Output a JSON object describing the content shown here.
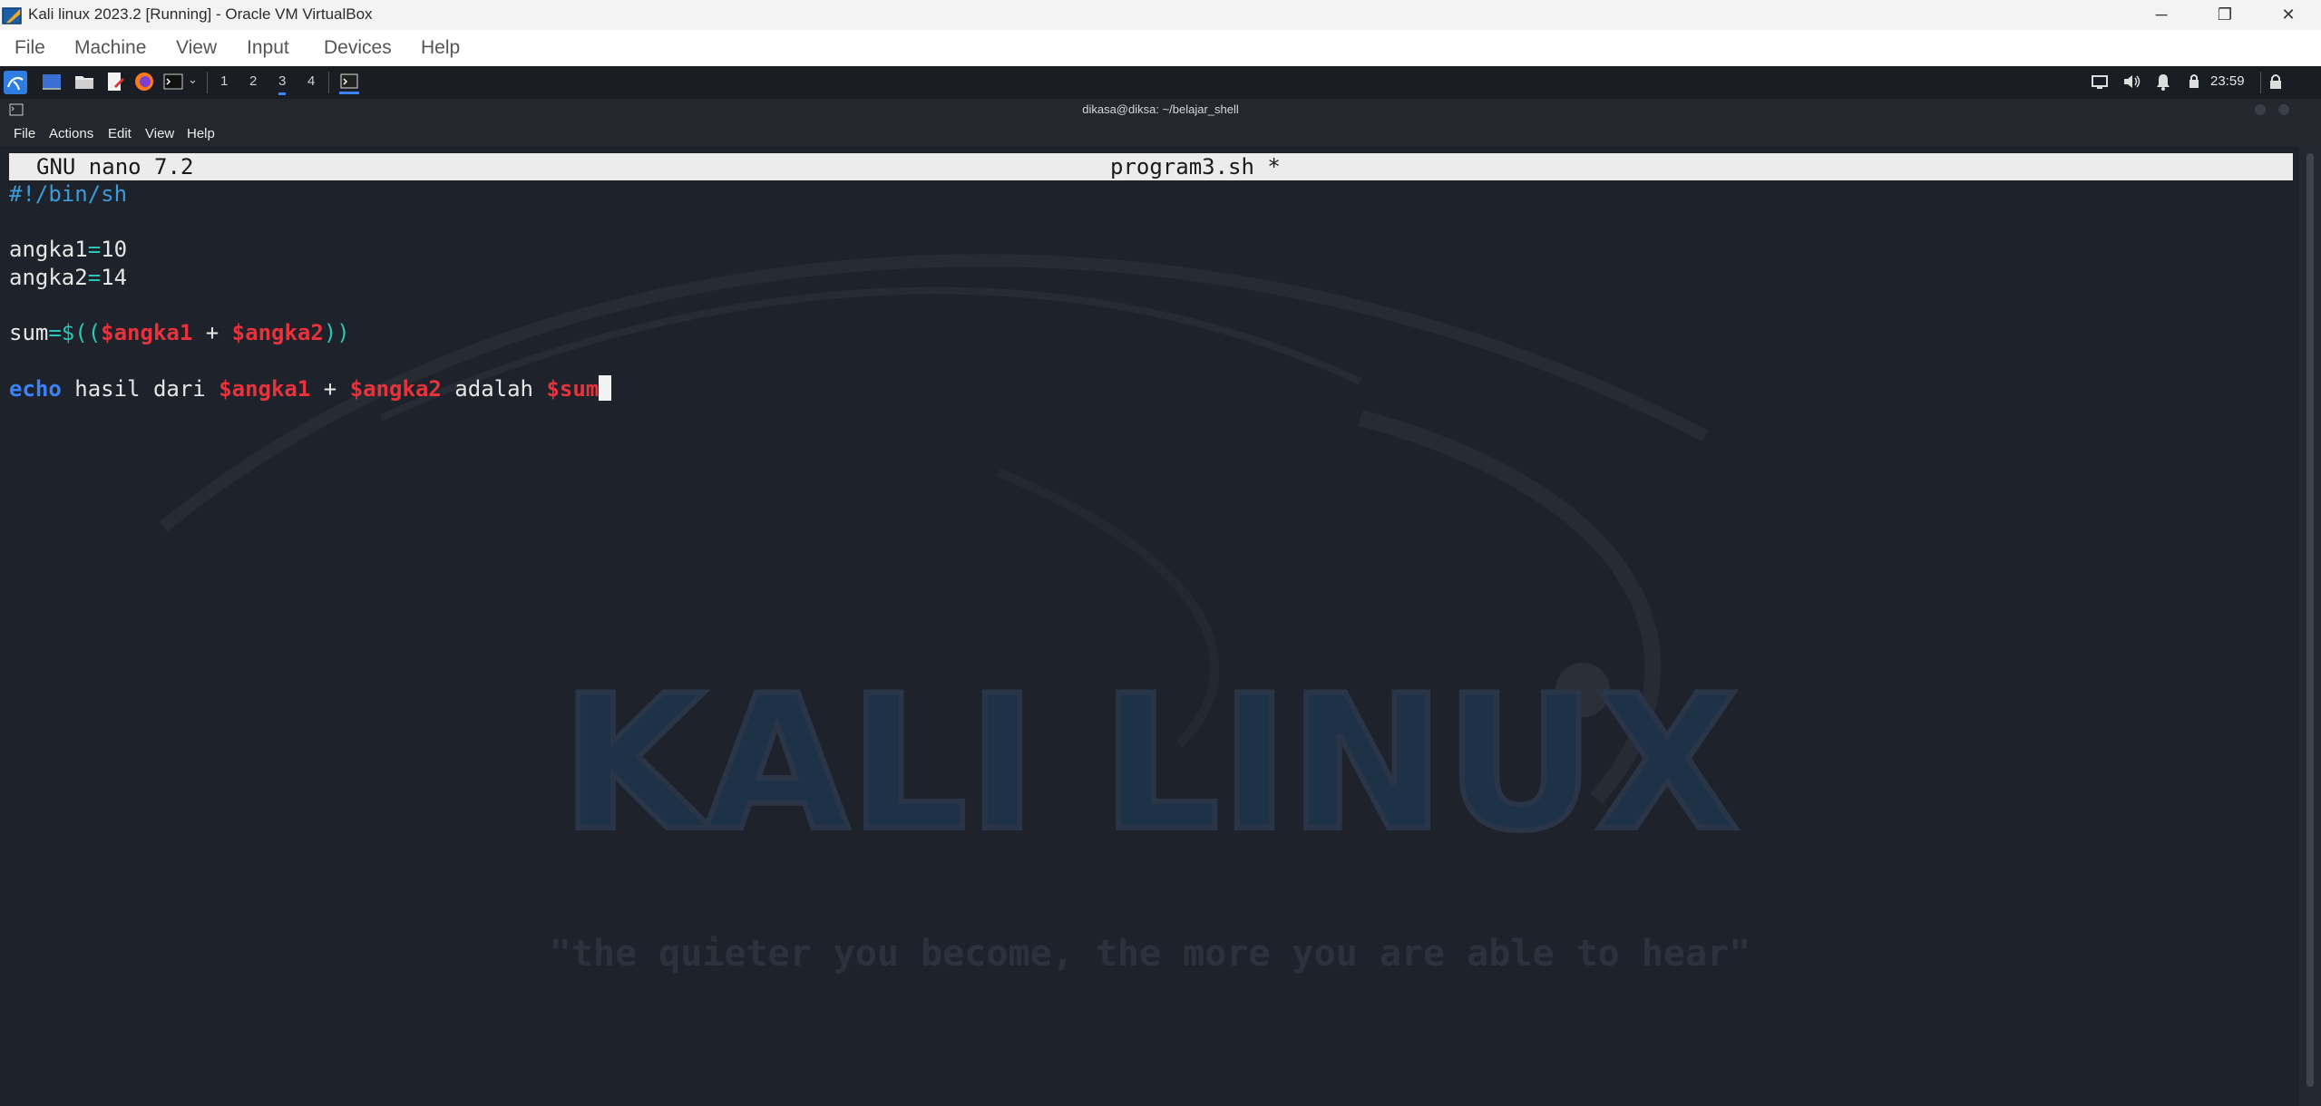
{
  "host_window": {
    "title": "Kali linux 2023.2 [Running] - Oracle VM VirtualBox",
    "controls": [
      "─",
      "❐",
      "✕"
    ]
  },
  "vbox_menu": [
    "File",
    "Machine",
    "View",
    "Input",
    "Devices",
    "Help"
  ],
  "xfce_panel": {
    "workspaces": [
      "1",
      "2",
      "3",
      "4"
    ],
    "active_workspace": "3",
    "clock": "23:59"
  },
  "terminal": {
    "title": "dikasa@diksa: ~/belajar_shell",
    "menu": [
      "File",
      "Actions",
      "Edit",
      "View",
      "Help"
    ]
  },
  "nano": {
    "version": "GNU nano 7.2",
    "filename": "program3.sh *",
    "lines": {
      "shebang": "#!/bin/sh",
      "l3_name": "angka1",
      "l3_eq": "=",
      "l3_val": "10",
      "l4_name": "angka2",
      "l4_eq": "=",
      "l4_val": "14",
      "l6_name": "sum",
      "l6_open": "=$((",
      "l6_var1": "$angka1",
      "l6_plus": " + ",
      "l6_var2": "$angka2",
      "l6_close": "))",
      "l8_kw": "echo",
      "l8_text1": " hasil dari ",
      "l8_var1": "$angka1",
      "l8_plus": " + ",
      "l8_var2": "$angka2",
      "l8_text2": " adalah ",
      "l8_var3": "$sum"
    }
  },
  "wallpaper": {
    "title": "KALI LINUX",
    "tagline": "\"the quieter you become, the more you are able to hear\""
  },
  "colors": {
    "keyword": "#3b82f6",
    "variable": "#e8323c",
    "operator": "#2ec4b6",
    "shebang": "#3d9ad8"
  }
}
